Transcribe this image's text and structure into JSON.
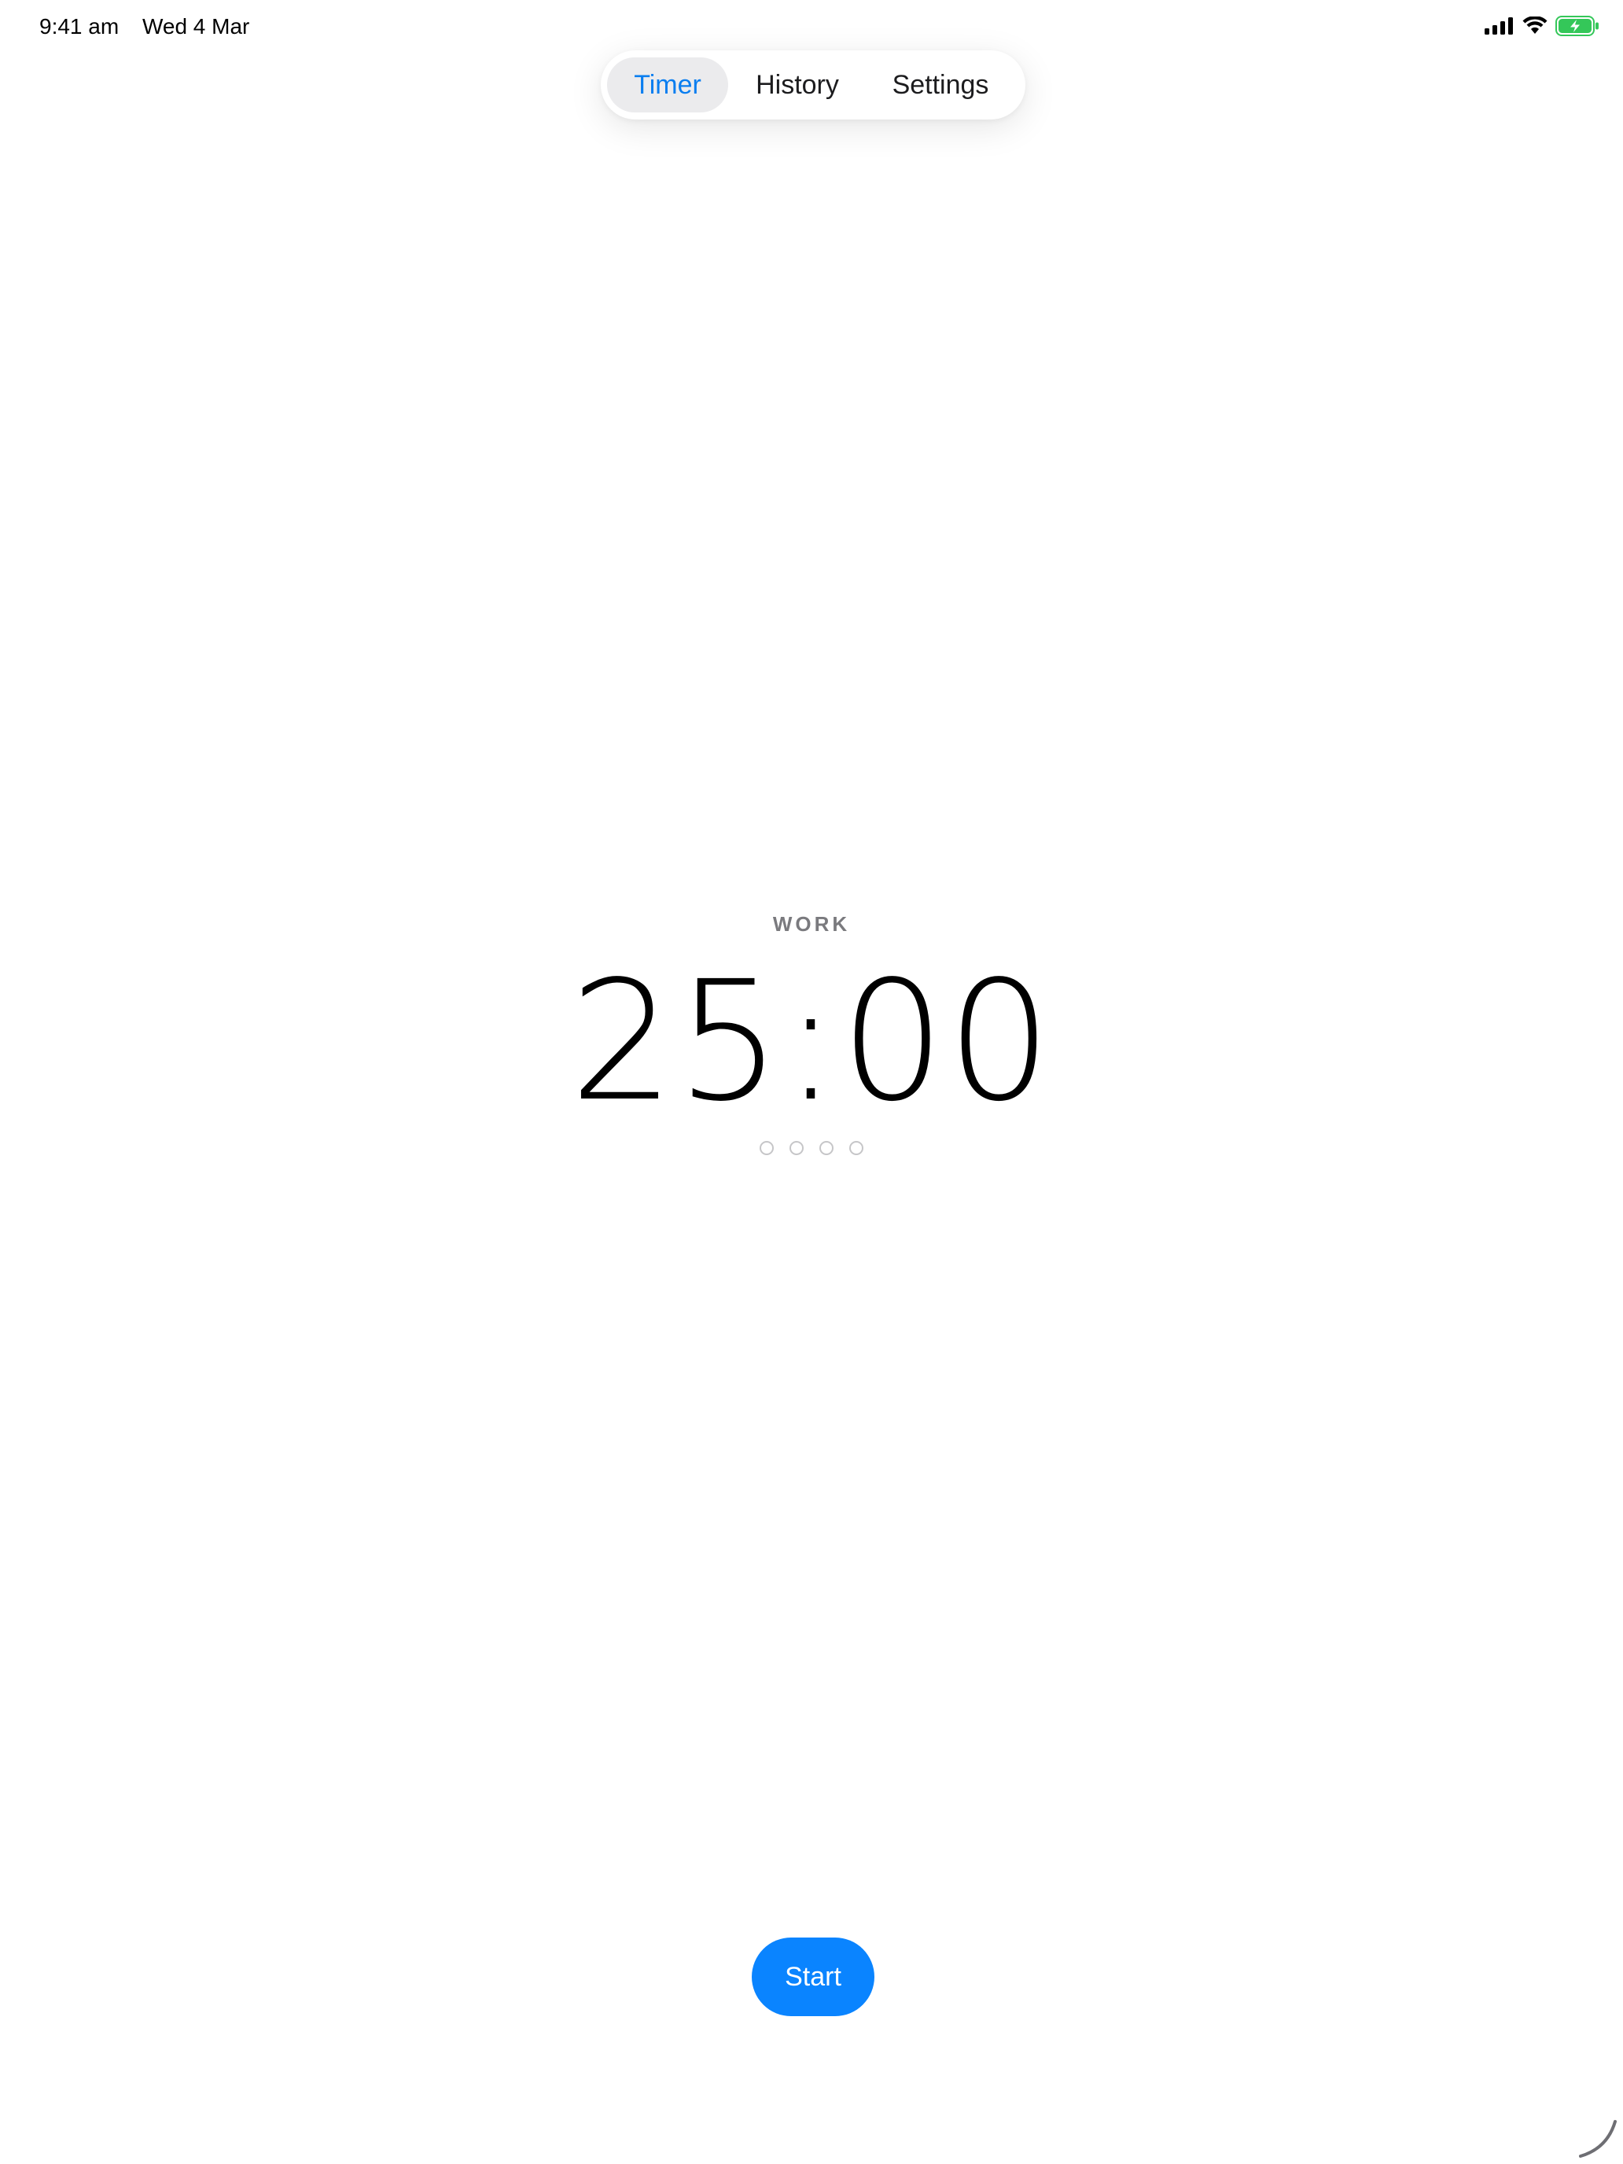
{
  "status_bar": {
    "time": "9:41 am",
    "date": "Wed 4 Mar",
    "icons": [
      "cellular-signal-icon",
      "wifi-icon",
      "battery-charging-icon"
    ],
    "battery_color": "#34c759"
  },
  "tabs": [
    {
      "label": "Timer",
      "selected": true
    },
    {
      "label": "History",
      "selected": false
    },
    {
      "label": "Settings",
      "selected": false
    }
  ],
  "timer": {
    "phase": "WORK",
    "time": "25:00",
    "sessions_total": 4,
    "sessions_completed": 0
  },
  "actions": {
    "start_label": "Start"
  },
  "colors": {
    "accent": "#0a84ff",
    "selected_tab_text": "#0a7ef0",
    "selected_tab_bg": "#ebebed",
    "secondary_text": "#7a7a7e"
  }
}
